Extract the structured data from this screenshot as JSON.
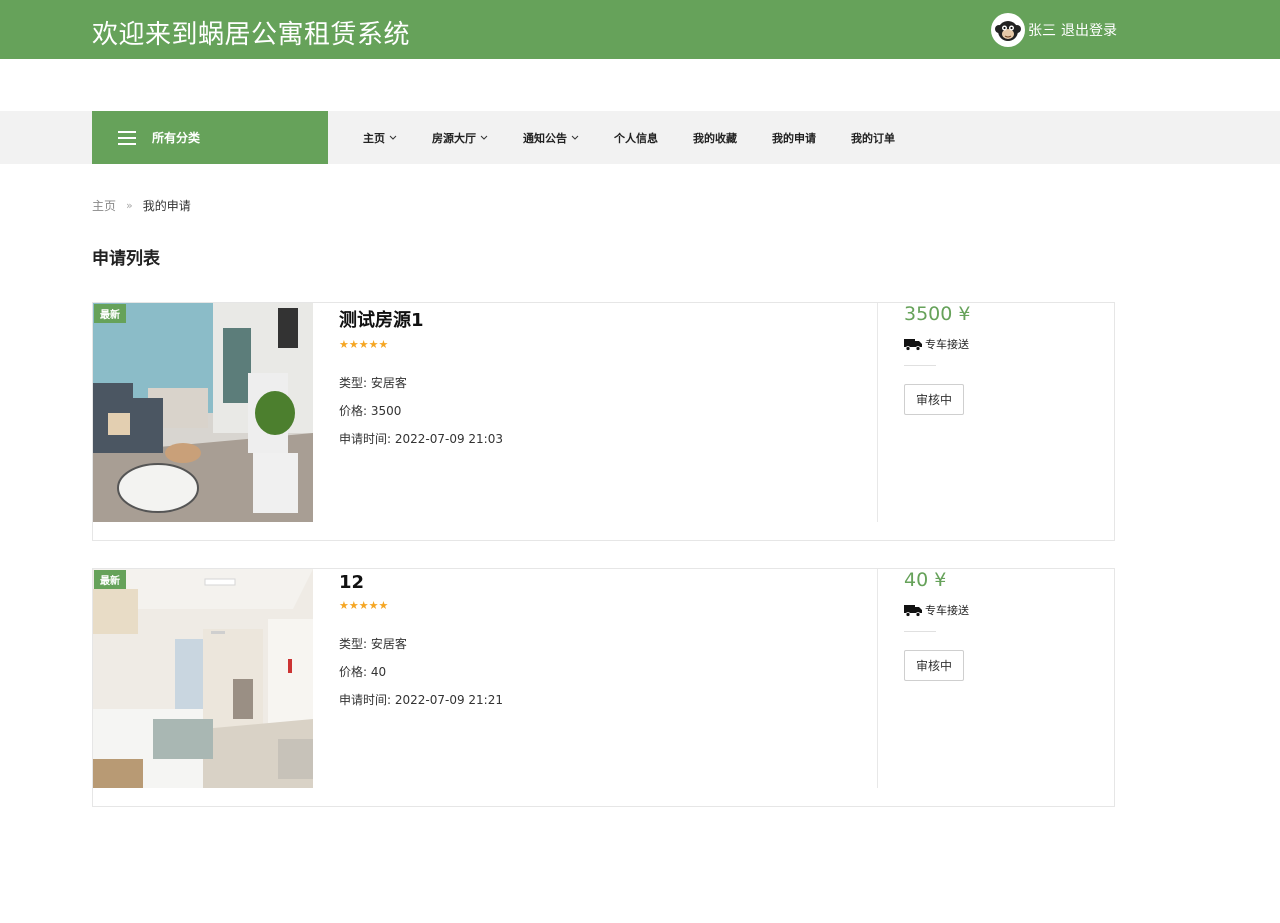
{
  "header": {
    "site_title": "欢迎来到蜗居公寓租赁系统",
    "avatar_icon": "monkey-avatar-icon",
    "user_name": "张三",
    "logout_label": "退出登录",
    "bg_color": "#66a25a"
  },
  "nav": {
    "category_label": "所有分类",
    "items": [
      {
        "label": "主页",
        "has_dropdown": true
      },
      {
        "label": "房源大厅",
        "has_dropdown": true
      },
      {
        "label": "通知公告",
        "has_dropdown": true
      },
      {
        "label": "个人信息",
        "has_dropdown": false
      },
      {
        "label": "我的收藏",
        "has_dropdown": false
      },
      {
        "label": "我的申请",
        "has_dropdown": false
      },
      {
        "label": "我的订单",
        "has_dropdown": false
      }
    ]
  },
  "breadcrumb": {
    "home": "主页",
    "separator": "»",
    "current": "我的申请"
  },
  "section_title": "申请列表",
  "applications": [
    {
      "badge": "最新",
      "title": "测试房源1",
      "stars": "★★★★★",
      "type_line": "类型:  安居客",
      "price_line": "价格: 3500",
      "time_line": "申请时间: 2022-07-09 21:03",
      "price_display": "3500 ¥",
      "delivery_icon": "truck-icon",
      "delivery_label": "专车接送",
      "status_label": "审核中"
    },
    {
      "badge": "最新",
      "title": "12",
      "stars": "★★★★★",
      "type_line": "类型:  安居客",
      "price_line": "价格: 40",
      "time_line": "申请时间: 2022-07-09 21:21",
      "price_display": "40 ¥",
      "delivery_icon": "truck-icon",
      "delivery_label": "专车接送",
      "status_label": "审核中"
    }
  ]
}
